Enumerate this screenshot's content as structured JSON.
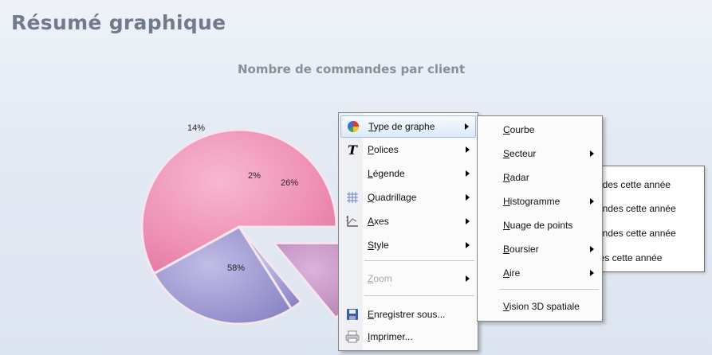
{
  "page": {
    "title": "Résumé graphique",
    "chart_title": "Nombre de commandes par client"
  },
  "chart_data": {
    "type": "pie",
    "title": "Nombre de commandes par client",
    "slices": [
      {
        "label": "58%",
        "value": 58,
        "color": "#e97ea6",
        "exploded": false
      },
      {
        "label": "14%",
        "value": 14,
        "color": "#c792c4",
        "exploded": true
      },
      {
        "label": "2%",
        "value": 2,
        "color": "#9a92cc",
        "exploded": false
      },
      {
        "label": "26%",
        "value": 26,
        "color": "#8f89c7",
        "exploded": false
      }
    ],
    "legend": [
      "ndes cette année",
      "andes cette année",
      "andes cette année",
      "les cette année"
    ]
  },
  "context_menu": {
    "items": [
      {
        "label": "Type de graphe",
        "underline": "T",
        "icon": "pie-chart-icon",
        "submenu": true,
        "highlighted": true
      },
      {
        "label": "Polices",
        "underline": "P",
        "icon": "font-icon",
        "submenu": true
      },
      {
        "label": "Légende",
        "underline": "L",
        "icon": "",
        "submenu": true
      },
      {
        "label": "Quadrillage",
        "underline": "Q",
        "icon": "grid-icon",
        "submenu": true
      },
      {
        "label": "Axes",
        "underline": "A",
        "icon": "axes-icon",
        "submenu": true
      },
      {
        "label": "Style",
        "underline": "S",
        "icon": "",
        "submenu": true
      },
      {
        "label": "Zoom",
        "underline": "Z",
        "icon": "",
        "submenu": true,
        "disabled": true
      },
      {
        "label": "Enregistrer sous...",
        "underline": "E",
        "icon": "save-icon",
        "submenu": false
      },
      {
        "label": "Imprimer...",
        "underline": "I",
        "icon": "printer-icon",
        "submenu": false
      }
    ]
  },
  "submenu": {
    "items": [
      {
        "label": "Courbe",
        "underline": "C",
        "submenu": false
      },
      {
        "label": "Secteur",
        "underline": "S",
        "submenu": true
      },
      {
        "label": "Radar",
        "underline": "R",
        "submenu": false
      },
      {
        "label": "Histogramme",
        "underline": "H",
        "submenu": true
      },
      {
        "label": "Nuage de points",
        "underline": "N",
        "submenu": false
      },
      {
        "label": "Boursier",
        "underline": "B",
        "submenu": true
      },
      {
        "label": "Aire",
        "underline": "A",
        "submenu": true
      },
      {
        "label": "Vision 3D spatiale",
        "underline": "V",
        "submenu": false
      }
    ]
  }
}
